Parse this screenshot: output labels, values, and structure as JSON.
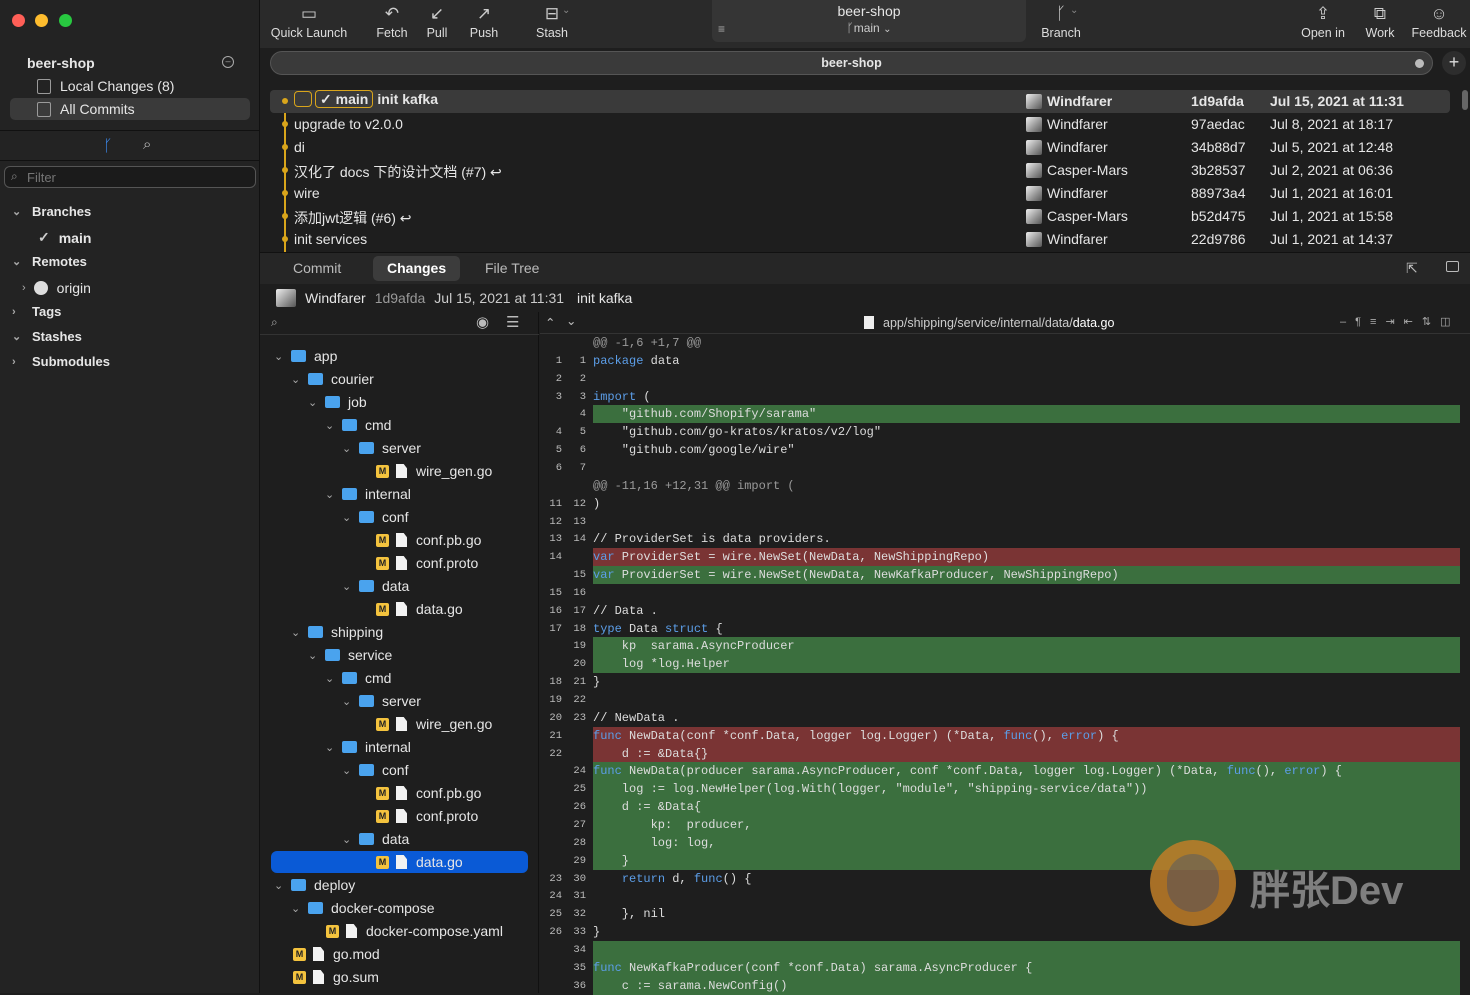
{
  "app": {
    "repo": "beer-shop",
    "branch": "main"
  },
  "sidebar": {
    "title": "beer-shop",
    "items": [
      {
        "label": "Local Changes (8)"
      },
      {
        "label": "All Commits"
      }
    ],
    "filter_placeholder": "Filter",
    "sections": [
      {
        "label": "Branches"
      },
      {
        "label": "Remotes"
      },
      {
        "label": "Tags"
      },
      {
        "label": "Stashes"
      },
      {
        "label": "Submodules"
      }
    ],
    "branch_main": "main",
    "remote_origin": "origin"
  },
  "toolbar": {
    "quick_launch": "Quick Launch",
    "fetch": "Fetch",
    "pull": "Pull",
    "push": "Push",
    "stash": "Stash",
    "branch": "Branch",
    "open_in": "Open in",
    "work": "Work",
    "feedback": "Feedback"
  },
  "pathbar": "beer-shop",
  "commits": [
    {
      "msg": "init kafka",
      "author": "Windfarer",
      "hash": "1d9afda",
      "date": "Jul 15, 2021 at 11:31",
      "tag": "main"
    },
    {
      "msg": "upgrade to v2.0.0",
      "author": "Windfarer",
      "hash": "97aedac",
      "date": "Jul 8, 2021 at 18:17"
    },
    {
      "msg": "di",
      "author": "Windfarer",
      "hash": "34b88d7",
      "date": "Jul 5, 2021 at 12:48"
    },
    {
      "msg": "汉化了 docs 下的设计文档 (#7) ↩",
      "author": "Casper-Mars",
      "hash": "3b28537",
      "date": "Jul 2, 2021 at 06:36"
    },
    {
      "msg": "wire",
      "author": "Windfarer",
      "hash": "88973a4",
      "date": "Jul 1, 2021 at 16:01"
    },
    {
      "msg": "添加jwt逻辑 (#6) ↩",
      "author": "Casper-Mars",
      "hash": "b52d475",
      "date": "Jul 1, 2021 at 15:58"
    },
    {
      "msg": "init services",
      "author": "Windfarer",
      "hash": "22d9786",
      "date": "Jul 1, 2021 at 14:37"
    }
  ],
  "tabs": [
    {
      "label": "Commit"
    },
    {
      "label": "Changes"
    },
    {
      "label": "File Tree"
    }
  ],
  "commit_info": {
    "author": "Windfarer",
    "hash": "1d9afda",
    "date": "Jul 15, 2021 at 11:31",
    "msg": "init kafka"
  },
  "file_path": {
    "dir": "app/shipping/service/internal/data/",
    "file": "data.go"
  },
  "tree": [
    {
      "label": "app",
      "kind": "folder"
    },
    {
      "label": "courier",
      "kind": "folder"
    },
    {
      "label": "job",
      "kind": "folder"
    },
    {
      "label": "cmd",
      "kind": "folder"
    },
    {
      "label": "server",
      "kind": "folder"
    },
    {
      "label": "wire_gen.go",
      "kind": "file",
      "badge": "M"
    },
    {
      "label": "internal",
      "kind": "folder"
    },
    {
      "label": "conf",
      "kind": "folder"
    },
    {
      "label": "conf.pb.go",
      "kind": "file",
      "badge": "M"
    },
    {
      "label": "conf.proto",
      "kind": "file",
      "badge": "M"
    },
    {
      "label": "data",
      "kind": "folder"
    },
    {
      "label": "data.go",
      "kind": "file",
      "badge": "M"
    },
    {
      "label": "shipping",
      "kind": "folder"
    },
    {
      "label": "service",
      "kind": "folder"
    },
    {
      "label": "cmd",
      "kind": "folder"
    },
    {
      "label": "server",
      "kind": "folder"
    },
    {
      "label": "wire_gen.go",
      "kind": "file",
      "badge": "M"
    },
    {
      "label": "internal",
      "kind": "folder"
    },
    {
      "label": "conf",
      "kind": "folder"
    },
    {
      "label": "conf.pb.go",
      "kind": "file",
      "badge": "M"
    },
    {
      "label": "conf.proto",
      "kind": "file",
      "badge": "M"
    },
    {
      "label": "data",
      "kind": "folder"
    },
    {
      "label": "data.go",
      "kind": "file",
      "badge": "M",
      "selected": true
    },
    {
      "label": "deploy",
      "kind": "folder"
    },
    {
      "label": "docker-compose",
      "kind": "folder"
    },
    {
      "label": "docker-compose.yaml",
      "kind": "file",
      "badge": "M"
    },
    {
      "label": "go.mod",
      "kind": "file",
      "badge": "M"
    },
    {
      "label": "go.sum",
      "kind": "file",
      "badge": "M"
    }
  ],
  "diff": [
    {
      "t": "hunk",
      "o": "",
      "n": "",
      "c": "@@ -1,6 +1,7 @@"
    },
    {
      "t": "ctx",
      "o": "1",
      "n": "1",
      "c": "package data"
    },
    {
      "t": "ctx",
      "o": "2",
      "n": "2",
      "c": ""
    },
    {
      "t": "ctx",
      "o": "3",
      "n": "3",
      "c": "import ("
    },
    {
      "t": "add",
      "o": "",
      "n": "4",
      "c": "    \"github.com/Shopify/sarama\""
    },
    {
      "t": "ctx",
      "o": "4",
      "n": "5",
      "c": "    \"github.com/go-kratos/kratos/v2/log\""
    },
    {
      "t": "ctx",
      "o": "5",
      "n": "6",
      "c": "    \"github.com/google/wire\""
    },
    {
      "t": "ctx",
      "o": "6",
      "n": "7",
      "c": ""
    },
    {
      "t": "hunk",
      "o": "",
      "n": "",
      "c": "@@ -11,16 +12,31 @@ import ("
    },
    {
      "t": "ctx",
      "o": "11",
      "n": "12",
      "c": ")"
    },
    {
      "t": "ctx",
      "o": "12",
      "n": "13",
      "c": ""
    },
    {
      "t": "ctx",
      "o": "13",
      "n": "14",
      "c": "// ProviderSet is data providers."
    },
    {
      "t": "del",
      "o": "14",
      "n": "",
      "c": "var ProviderSet = wire.NewSet(NewData, NewShippingRepo)"
    },
    {
      "t": "add",
      "o": "",
      "n": "15",
      "c": "var ProviderSet = wire.NewSet(NewData, NewKafkaProducer, NewShippingRepo)"
    },
    {
      "t": "ctx",
      "o": "15",
      "n": "16",
      "c": ""
    },
    {
      "t": "ctx",
      "o": "16",
      "n": "17",
      "c": "// Data ."
    },
    {
      "t": "ctx",
      "o": "17",
      "n": "18",
      "c": "type Data struct {"
    },
    {
      "t": "add",
      "o": "",
      "n": "19",
      "c": "    kp  sarama.AsyncProducer"
    },
    {
      "t": "add",
      "o": "",
      "n": "20",
      "c": "    log *log.Helper"
    },
    {
      "t": "ctx",
      "o": "18",
      "n": "21",
      "c": "}"
    },
    {
      "t": "ctx",
      "o": "19",
      "n": "22",
      "c": ""
    },
    {
      "t": "ctx",
      "o": "20",
      "n": "23",
      "c": "// NewData ."
    },
    {
      "t": "del",
      "o": "21",
      "n": "",
      "c": "func NewData(conf *conf.Data, logger log.Logger) (*Data, func(), error) {"
    },
    {
      "t": "del",
      "o": "22",
      "n": "",
      "c": "    d := &Data{}"
    },
    {
      "t": "add",
      "o": "",
      "n": "24",
      "c": "func NewData(producer sarama.AsyncProducer, conf *conf.Data, logger log.Logger) (*Data, func(), error) {"
    },
    {
      "t": "add",
      "o": "",
      "n": "25",
      "c": "    log := log.NewHelper(log.With(logger, \"module\", \"shipping-service/data\"))"
    },
    {
      "t": "add",
      "o": "",
      "n": "26",
      "c": "    d := &Data{"
    },
    {
      "t": "add",
      "o": "",
      "n": "27",
      "c": "        kp:  producer,"
    },
    {
      "t": "add",
      "o": "",
      "n": "28",
      "c": "        log: log,"
    },
    {
      "t": "add",
      "o": "",
      "n": "29",
      "c": "    }"
    },
    {
      "t": "ctx",
      "o": "23",
      "n": "30",
      "c": "    return d, func() {"
    },
    {
      "t": "ctx",
      "o": "24",
      "n": "31",
      "c": ""
    },
    {
      "t": "ctx",
      "o": "25",
      "n": "32",
      "c": "    }, nil"
    },
    {
      "t": "ctx",
      "o": "26",
      "n": "33",
      "c": "}"
    },
    {
      "t": "add",
      "o": "",
      "n": "34",
      "c": ""
    },
    {
      "t": "add",
      "o": "",
      "n": "35",
      "c": "func NewKafkaProducer(conf *conf.Data) sarama.AsyncProducer {"
    },
    {
      "t": "add",
      "o": "",
      "n": "36",
      "c": "    c := sarama.NewConfig()"
    }
  ],
  "watermark": "胖张Dev",
  "colors": {
    "accent": "#0a5ad6",
    "graph": "#d9a51b",
    "added": "#3b6f3e",
    "removed": "#7a3434",
    "keyword": "#5c9ee8"
  }
}
